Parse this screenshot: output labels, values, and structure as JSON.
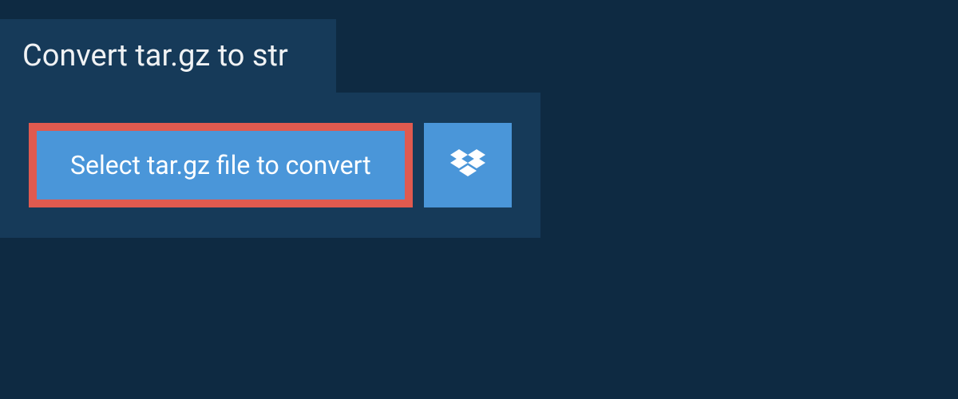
{
  "header": {
    "title": "Convert tar.gz to str"
  },
  "upload": {
    "select_label": "Select tar.gz file to convert",
    "dropbox_icon": "dropbox"
  },
  "colors": {
    "page_bg": "#0e2a42",
    "panel_bg": "#163a59",
    "button_bg": "#4a96d9",
    "button_border": "#e05a4f",
    "text_light": "#f0f2f4"
  }
}
